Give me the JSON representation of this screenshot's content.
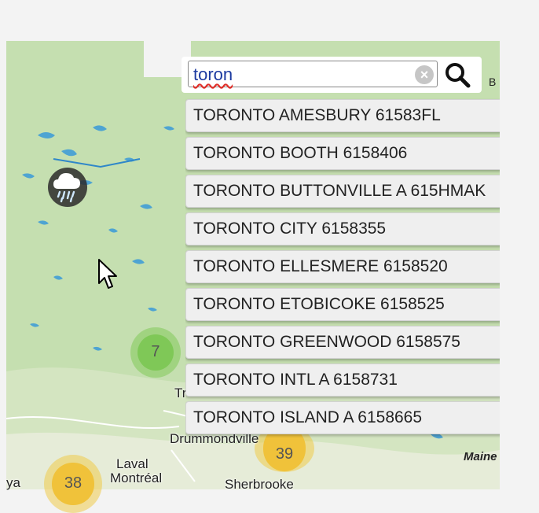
{
  "search": {
    "value": "toron",
    "clear_icon": "clear-x-icon",
    "search_icon": "magnifier-icon"
  },
  "results": [
    {
      "label": "TORONTO AMESBURY 61583FL"
    },
    {
      "label": "TORONTO BOOTH 6158406"
    },
    {
      "label": "TORONTO BUTTONVILLE A 615HMAK"
    },
    {
      "label": "TORONTO CITY 6158355"
    },
    {
      "label": "TORONTO ELLESMERE 6158520"
    },
    {
      "label": "TORONTO ETOBICOKE 6158525"
    },
    {
      "label": "TORONTO GREENWOOD 6158575"
    },
    {
      "label": "TORONTO INTL A 6158731"
    },
    {
      "label": "TORONTO ISLAND A 6158665"
    }
  ],
  "clusters": [
    {
      "count": "7",
      "color": "#7fc857"
    },
    {
      "count": "38",
      "color": "#f0c23a"
    },
    {
      "count": "39",
      "color": "#f0c23a"
    }
  ],
  "map_labels": {
    "laval": "Laval",
    "montreal": "Montréal",
    "sherbrooke": "Sherbrooke",
    "drummondville": "Drummondville",
    "maine": "Maine",
    "edge_b": "B",
    "edge_tr": "Tr",
    "edge_ya": "ya"
  },
  "weather_marker": {
    "icon": "rain-cloud-icon"
  },
  "colors": {
    "land": "#c9e2b6",
    "water": "#3a9ad9",
    "cluster_green": "#7fc857",
    "cluster_yellow": "#f0c23a",
    "result_bg": "#efefef"
  }
}
